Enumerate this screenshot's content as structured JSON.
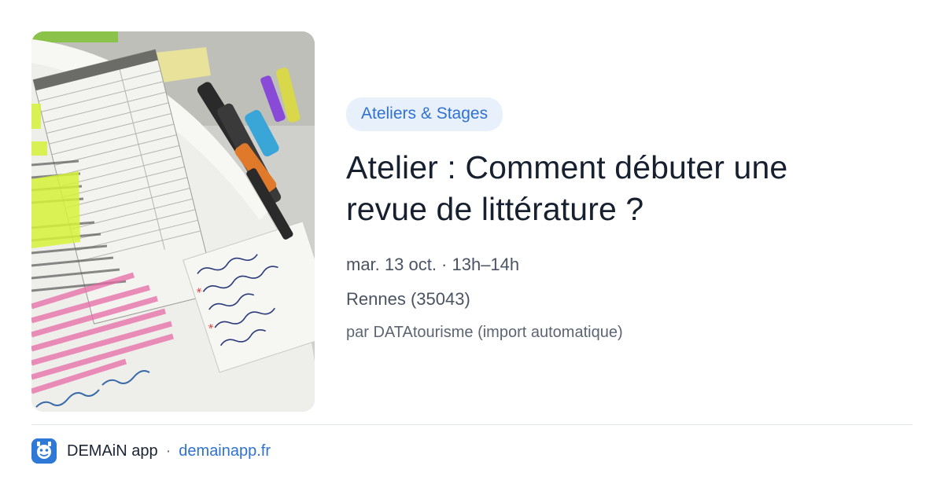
{
  "card": {
    "image_alt": "Livre ouvert annoté avec surligneurs",
    "tag": "Ateliers & Stages",
    "title": "Atelier : Comment débuter une revue de littérature ?",
    "date": "mar. 13 oct. · 13h–14h",
    "location": "Rennes (35043)",
    "source": "par DATAtourisme (import automatique)"
  },
  "footer": {
    "app_icon": "app-logo-icon",
    "app_name": "DEMAiN app",
    "separator": "·",
    "url": "demainapp.fr"
  },
  "colors": {
    "tag_bg": "#e8f0fc",
    "accent": "#2f72cf",
    "title": "#17202f",
    "meta": "#4b5363",
    "divider": "#e3e6ea",
    "app_icon_bg": "#2e78d7"
  }
}
